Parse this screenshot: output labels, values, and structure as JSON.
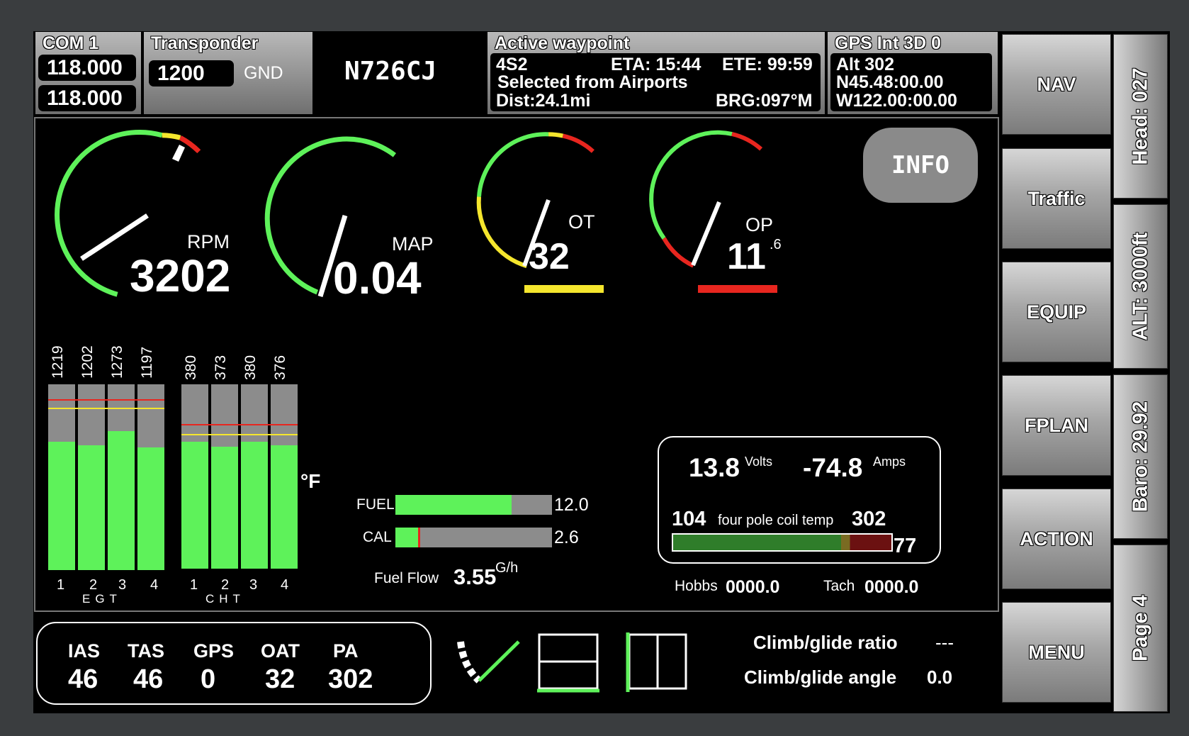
{
  "header": {
    "com": {
      "title": "COM 1",
      "active": "118.000",
      "standby": "118.000"
    },
    "transponder": {
      "title": "Transponder",
      "code": "1200",
      "mode": "GND"
    },
    "tail_number": "N726CJ",
    "waypoint": {
      "title": "Active waypoint",
      "id": "4S2",
      "eta": "ETA: 15:44",
      "ete": "ETE: 99:59",
      "source": "Selected from Airports",
      "dist": "Dist:24.1mi",
      "brg": "BRG:097°M"
    },
    "gps": {
      "title": "GPS   Int 3D 0",
      "alt": "Alt   302",
      "lat": "N45.48:00.00",
      "lon": "W122.00:00.00"
    }
  },
  "gauges": {
    "rpm": {
      "label": "RPM",
      "value": "3202",
      "level": 0.6
    },
    "map": {
      "label": "MAP",
      "value": "0.04",
      "level": 0.02
    },
    "ot": {
      "label": "OT",
      "value": "32",
      "level": 0.05
    },
    "op": {
      "label": "OP",
      "value": "11",
      "decimal": ".6",
      "level": 0.05
    }
  },
  "info_button": "INFO",
  "egt": {
    "labels": [
      "1219",
      "1202",
      "1273",
      "1197"
    ],
    "fill": [
      0.69,
      0.67,
      0.75,
      0.66
    ],
    "cylinders": [
      "1",
      "2",
      "3",
      "4"
    ],
    "title": "EGT"
  },
  "cht": {
    "labels": [
      "380",
      "373",
      "380",
      "376"
    ],
    "fill": [
      0.69,
      0.66,
      0.69,
      0.67
    ],
    "cylinders": [
      "1",
      "2",
      "3",
      "4"
    ],
    "title": "CHT"
  },
  "temp_unit": "°F",
  "fuel": {
    "label": "FUEL",
    "value": "12.0",
    "fill": 0.74
  },
  "cal": {
    "label": "CAL",
    "value": "2.6",
    "fill": 0.16
  },
  "fuel_flow": {
    "label": "Fuel Flow",
    "value": "3.55",
    "unit": "G/h"
  },
  "electrical": {
    "volts": "13.8",
    "volts_unit": "Volts",
    "amps": "-74.8",
    "amps_unit": "Amps",
    "coil_left": "104",
    "coil_label": "four pole coil temp",
    "coil_right": "302",
    "coil_value": "77",
    "coil_fill": 0.77
  },
  "hobbs": {
    "label": "Hobbs",
    "value": "0000.0"
  },
  "tach": {
    "label": "Tach",
    "value": "0000.0"
  },
  "air": [
    {
      "label": "IAS",
      "value": "46"
    },
    {
      "label": "TAS",
      "value": "46"
    },
    {
      "label": "GPS",
      "value": "0"
    },
    {
      "label": "OAT",
      "value": "32"
    },
    {
      "label": "PA",
      "value": "302"
    }
  ],
  "climb": {
    "ratio_label": "Climb/glide ratio",
    "ratio_value": "---",
    "angle_label": "Climb/glide angle",
    "angle_value": "0.0"
  },
  "side_buttons": [
    "NAV",
    "Traffic",
    "EQUIP",
    "FPLAN",
    "ACTION",
    "MENU"
  ],
  "status_buttons": [
    "Head: 027",
    "ALT: 3000ft",
    "Baro: 29.92",
    "Page 4"
  ],
  "colors": {
    "green": "#5ef25a",
    "yellow": "#f5e62d",
    "red": "#e8261f",
    "background": "#000000"
  }
}
